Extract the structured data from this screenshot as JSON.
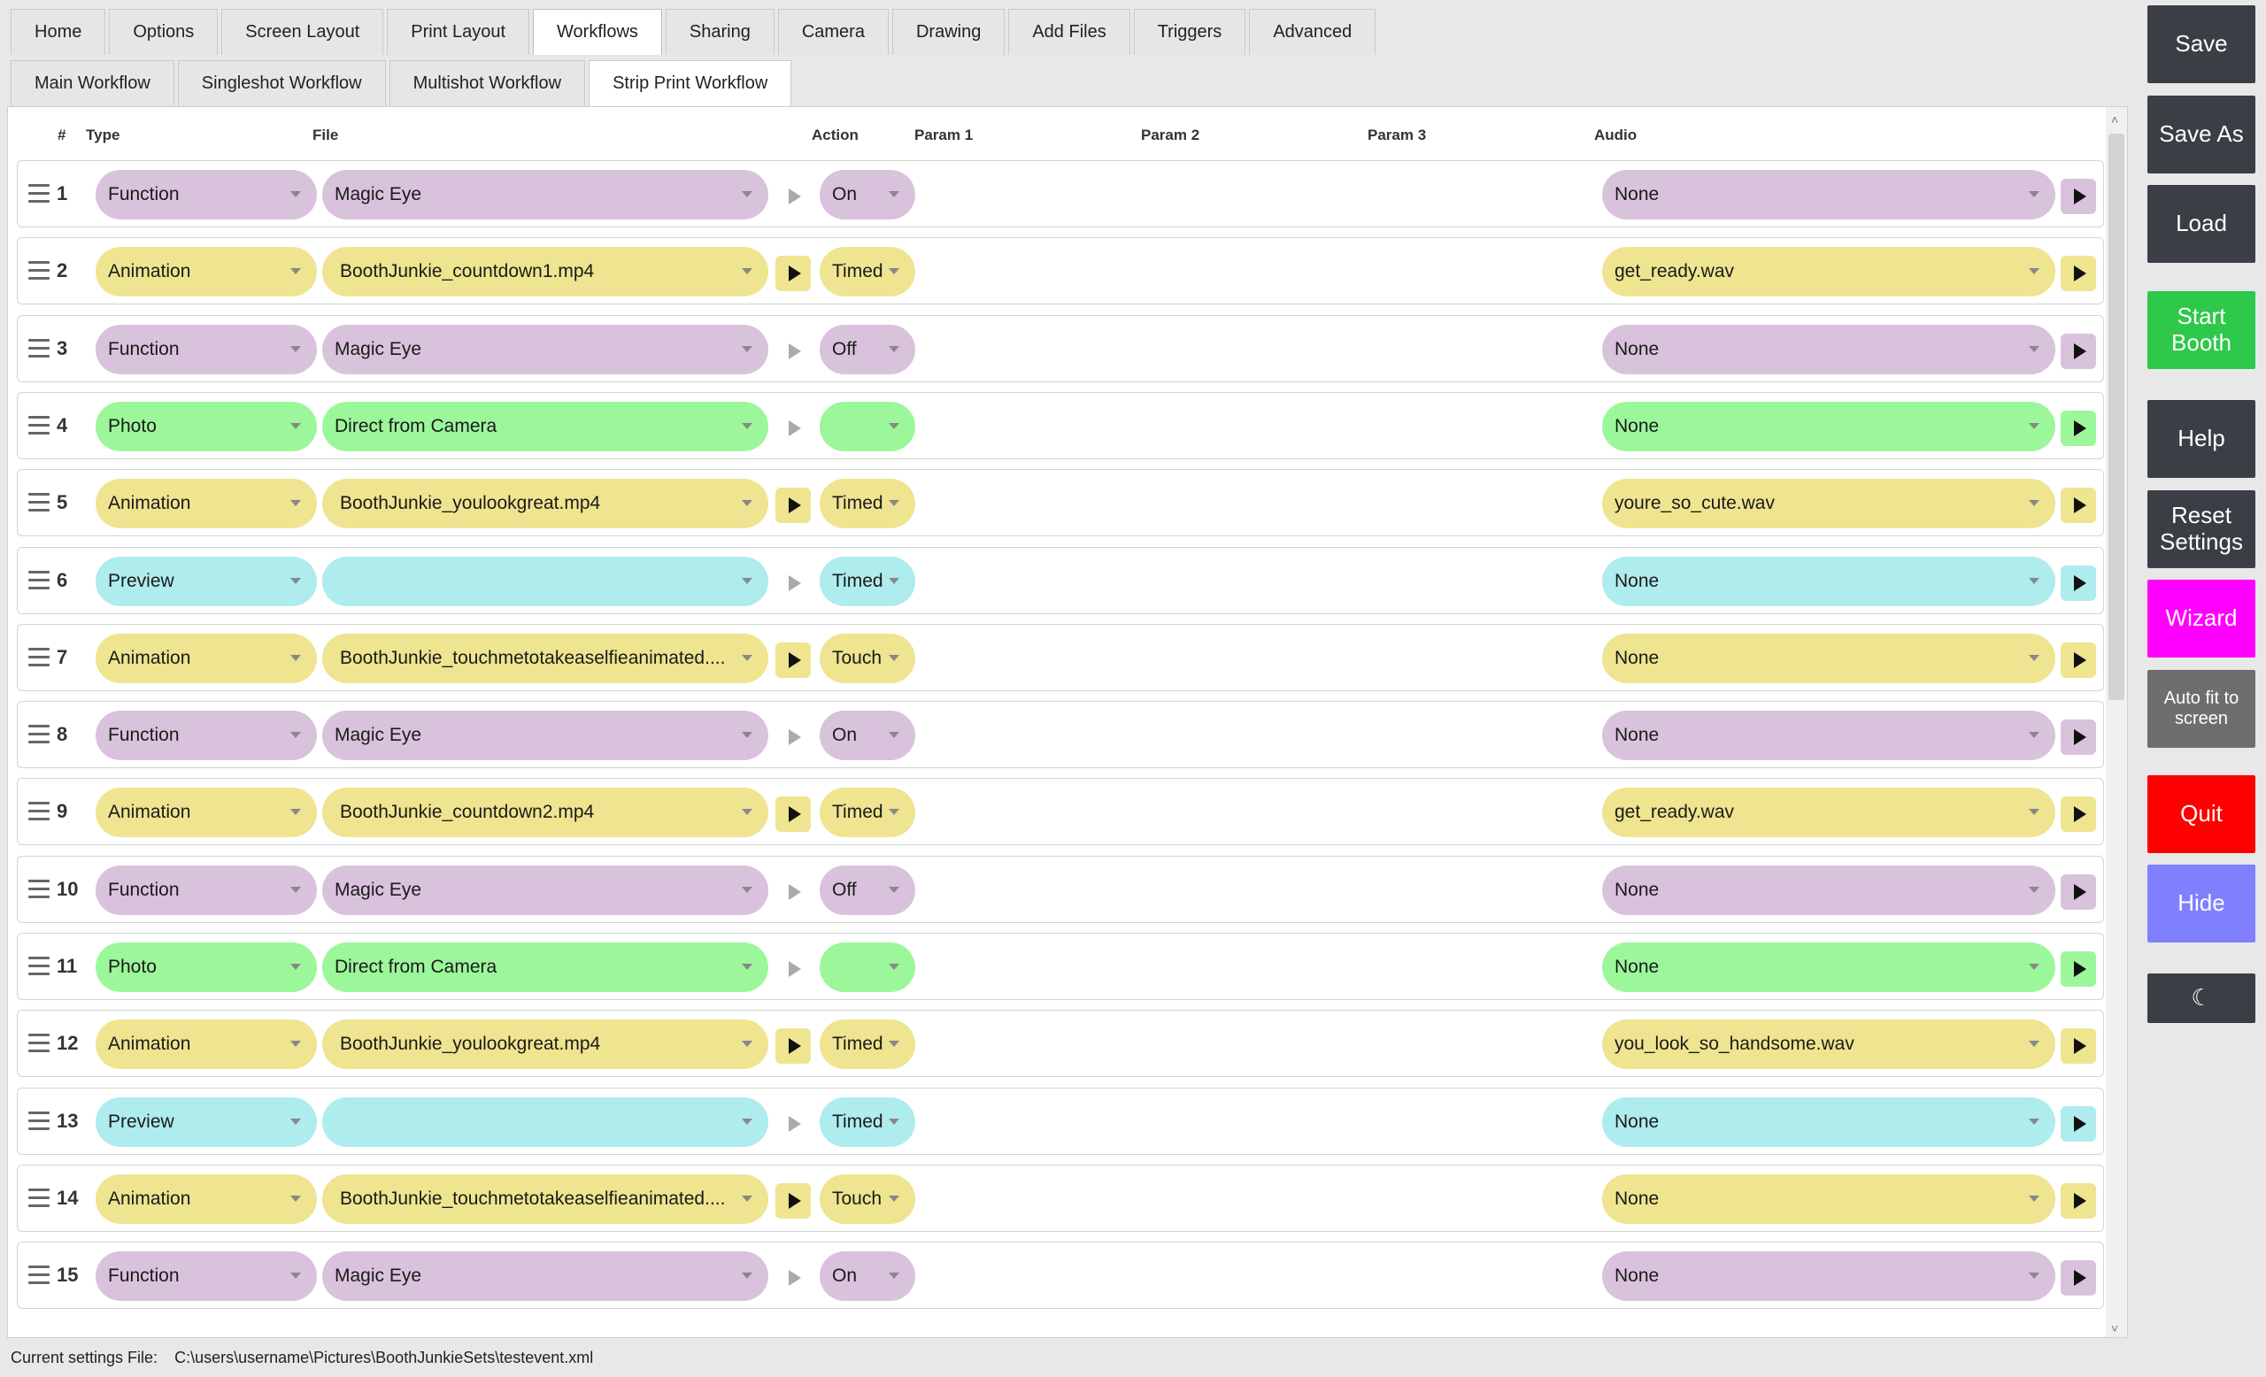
{
  "tabs": [
    "Home",
    "Options",
    "Screen Layout",
    "Print Layout",
    "Workflows",
    "Sharing",
    "Camera",
    "Drawing",
    "Add Files",
    "Triggers",
    "Advanced"
  ],
  "active_tab": "Workflows",
  "subtabs": [
    "Main Workflow",
    "Singleshot Workflow",
    "Multishot Workflow",
    "Strip Print Workflow"
  ],
  "active_subtab": "Strip Print Workflow",
  "columns": {
    "num": "#",
    "type": "Type",
    "file": "File",
    "action": "Action",
    "param1": "Param 1",
    "param2": "Param 2",
    "param3": "Param 3",
    "audio": "Audio"
  },
  "colors": {
    "purple": "#d9c2dc",
    "yellow": "#efe48f",
    "green": "#9cf79a",
    "cyan": "#aeecee"
  },
  "rows": [
    {
      "num": "1",
      "type": "Function",
      "file": "Magic Eye",
      "action": "On",
      "audio": "None",
      "color": "purple"
    },
    {
      "num": "2",
      "type": "Animation",
      "file": "BoothJunkie_countdown1.mp4",
      "action": "Timed",
      "audio": "get_ready.wav",
      "color": "yellow"
    },
    {
      "num": "3",
      "type": "Function",
      "file": "Magic Eye",
      "action": "Off",
      "audio": "None",
      "color": "purple"
    },
    {
      "num": "4",
      "type": "Photo",
      "file": "Direct from Camera",
      "action": "",
      "audio": "None",
      "color": "green"
    },
    {
      "num": "5",
      "type": "Animation",
      "file": "BoothJunkie_youlookgreat.mp4",
      "action": "Timed",
      "audio": "youre_so_cute.wav",
      "color": "yellow"
    },
    {
      "num": "6",
      "type": "Preview",
      "file": "",
      "action": "Timed",
      "audio": "None",
      "color": "cyan"
    },
    {
      "num": "7",
      "type": "Animation",
      "file": "BoothJunkie_touchmetotakeaselfieanimated....",
      "action": "Touch",
      "audio": "None",
      "color": "yellow"
    },
    {
      "num": "8",
      "type": "Function",
      "file": "Magic Eye",
      "action": "On",
      "audio": "None",
      "color": "purple"
    },
    {
      "num": "9",
      "type": "Animation",
      "file": "BoothJunkie_countdown2.mp4",
      "action": "Timed",
      "audio": "get_ready.wav",
      "color": "yellow"
    },
    {
      "num": "10",
      "type": "Function",
      "file": "Magic Eye",
      "action": "Off",
      "audio": "None",
      "color": "purple"
    },
    {
      "num": "11",
      "type": "Photo",
      "file": "Direct from Camera",
      "action": "",
      "audio": "None",
      "color": "green"
    },
    {
      "num": "12",
      "type": "Animation",
      "file": "BoothJunkie_youlookgreat.mp4",
      "action": "Timed",
      "audio": "you_look_so_handsome.wav",
      "color": "yellow"
    },
    {
      "num": "13",
      "type": "Preview",
      "file": "",
      "action": "Timed",
      "audio": "None",
      "color": "cyan"
    },
    {
      "num": "14",
      "type": "Animation",
      "file": "BoothJunkie_touchmetotakeaselfieanimated....",
      "action": "Touch",
      "audio": "None",
      "color": "yellow"
    },
    {
      "num": "15",
      "type": "Function",
      "file": "Magic Eye",
      "action": "On",
      "audio": "None",
      "color": "purple"
    }
  ],
  "sidebar": [
    {
      "label": "Save",
      "color": "#3b3f45"
    },
    {
      "label": "Save As",
      "color": "#3b3f45"
    },
    {
      "label": "Load",
      "color": "#3b3f45"
    },
    {
      "label": "Start Booth",
      "color": "#2ec84a"
    },
    {
      "label": "Help",
      "color": "#3b3f45"
    },
    {
      "label": "Reset Settings",
      "color": "#3b3f45"
    },
    {
      "label": "Wizard",
      "color": "#ff00ff"
    },
    {
      "label": "Auto fit to screen",
      "color": "#6e6e6e"
    },
    {
      "label": "Quit",
      "color": "#ff0000"
    },
    {
      "label": "Hide",
      "color": "#8080ff"
    },
    {
      "label": "☾",
      "color": "#3b3f45"
    }
  ],
  "status": {
    "label": "Current settings File:",
    "path": "C:\\users\\username\\Pictures\\BoothJunkieSets\\testevent.xml"
  }
}
